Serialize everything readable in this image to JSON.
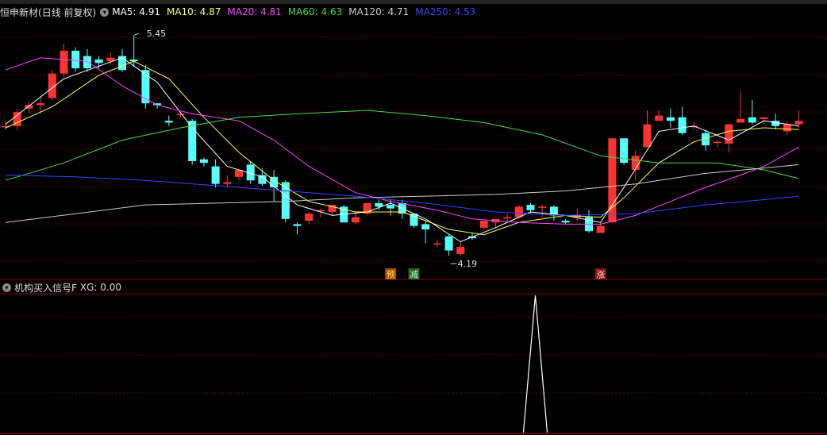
{
  "stock": {
    "name": "恒申新材",
    "period": "(日线 前复权)"
  },
  "ma_legend": [
    {
      "label": "MA5: 4.91",
      "color": "#ffffff"
    },
    {
      "label": "MA10: 4.87",
      "color": "#ffff55"
    },
    {
      "label": "MA20: 4.81",
      "color": "#ff44ff"
    },
    {
      "label": "MA60: 4.63",
      "color": "#44dd44"
    },
    {
      "label": "MA120: 4.71",
      "color": "#cccccc"
    },
    {
      "label": "MA250: 4.53",
      "color": "#3344ff"
    }
  ],
  "indicator": {
    "name": "机构买入信号F",
    "value_label": "XG: 0.00"
  },
  "colors": {
    "up": "#ff3333",
    "down": "#54ffff",
    "grid": "#6e0000",
    "border": "#a00000"
  },
  "signals": [
    {
      "label": "预",
      "index": 33,
      "bg": "#aa4400",
      "color": "#ffee66"
    },
    {
      "label": "减",
      "index": 35,
      "bg": "#226622",
      "color": "#ccffcc"
    },
    {
      "label": "涨",
      "index": 51,
      "bg": "#881111",
      "color": "#ffdddd"
    }
  ],
  "chart_data": {
    "type": "candlestick",
    "price_range": [
      4.1,
      5.55
    ],
    "annotations": [
      {
        "text": "5.45",
        "index": 11,
        "price": 5.45,
        "kind": "high"
      },
      {
        "text": "4.19",
        "index": 38,
        "price": 4.19,
        "kind": "low"
      }
    ],
    "candles": [
      [
        4.93,
        4.96,
        4.93,
        4.91
      ],
      [
        4.93,
        5.03,
        5.01,
        4.91
      ],
      [
        5.03,
        5.07,
        5.05,
        5.0
      ],
      [
        5.05,
        5.1,
        5.06,
        5.0
      ],
      [
        5.09,
        5.25,
        5.23,
        5.08
      ],
      [
        5.23,
        5.4,
        5.36,
        5.21
      ],
      [
        5.36,
        5.38,
        5.26,
        5.24
      ],
      [
        5.33,
        5.37,
        5.26,
        5.24
      ],
      [
        5.31,
        5.33,
        5.29,
        5.26
      ],
      [
        5.3,
        5.35,
        5.32,
        5.28
      ],
      [
        5.33,
        5.37,
        5.25,
        5.24
      ],
      [
        5.31,
        5.45,
        5.3,
        5.27
      ],
      [
        5.25,
        5.28,
        5.06,
        5.03
      ],
      [
        5.06,
        5.06,
        5.05,
        5.03
      ],
      [
        4.96,
        4.99,
        4.95,
        4.93
      ],
      [
        5.0,
        5.01,
        5.0,
        4.98
      ],
      [
        4.96,
        4.97,
        4.73,
        4.71
      ],
      [
        4.74,
        4.75,
        4.72,
        4.7
      ],
      [
        4.7,
        4.74,
        4.6,
        4.58
      ],
      [
        4.6,
        4.65,
        4.61,
        4.58
      ],
      [
        4.64,
        4.67,
        4.68,
        4.62
      ],
      [
        4.71,
        4.73,
        4.62,
        4.6
      ],
      [
        4.65,
        4.69,
        4.6,
        4.59
      ],
      [
        4.64,
        4.68,
        4.58,
        4.5
      ],
      [
        4.61,
        4.62,
        4.4,
        4.38
      ],
      [
        4.37,
        4.38,
        4.36,
        4.31
      ],
      [
        4.39,
        4.44,
        4.43,
        4.37
      ],
      [
        4.45,
        4.46,
        4.45,
        4.41
      ],
      [
        4.44,
        4.46,
        4.48,
        4.42
      ],
      [
        4.47,
        4.48,
        4.38,
        4.38
      ],
      [
        4.38,
        4.44,
        4.41,
        4.37
      ],
      [
        4.43,
        4.48,
        4.49,
        4.42
      ],
      [
        4.49,
        4.51,
        4.47,
        4.45
      ],
      [
        4.48,
        4.51,
        4.46,
        4.42
      ],
      [
        4.49,
        4.51,
        4.43,
        4.4
      ],
      [
        4.43,
        4.43,
        4.36,
        4.35
      ],
      [
        4.37,
        4.39,
        4.34,
        4.26
      ],
      [
        4.26,
        4.28,
        4.26,
        4.24
      ],
      [
        4.3,
        4.31,
        4.22,
        4.19
      ],
      [
        4.2,
        4.27,
        4.24,
        4.19
      ],
      [
        4.3,
        4.32,
        4.29,
        4.28
      ],
      [
        4.35,
        4.38,
        4.39,
        4.34
      ],
      [
        4.38,
        4.4,
        4.4,
        4.35
      ],
      [
        4.41,
        4.43,
        4.41,
        4.39
      ],
      [
        4.41,
        4.48,
        4.47,
        4.4
      ],
      [
        4.48,
        4.49,
        4.45,
        4.43
      ],
      [
        4.47,
        4.48,
        4.47,
        4.41
      ],
      [
        4.47,
        4.48,
        4.42,
        4.39
      ],
      [
        4.39,
        4.4,
        4.38,
        4.37
      ],
      [
        4.41,
        4.46,
        4.42,
        4.39
      ],
      [
        4.41,
        4.45,
        4.33,
        4.32
      ],
      [
        4.32,
        4.38,
        4.36,
        4.34
      ],
      [
        4.38,
        4.86,
        4.86,
        4.4
      ],
      [
        4.86,
        4.86,
        4.72,
        4.71
      ],
      [
        4.68,
        4.79,
        4.76,
        4.62
      ],
      [
        4.81,
        5.02,
        4.94,
        4.81
      ],
      [
        4.96,
        5.02,
        4.99,
        4.96
      ],
      [
        4.98,
        5.03,
        4.96,
        4.92
      ],
      [
        4.98,
        5.04,
        4.89,
        4.88
      ],
      [
        4.93,
        4.95,
        4.93,
        4.91
      ],
      [
        4.89,
        4.91,
        4.82,
        4.79
      ],
      [
        4.84,
        4.85,
        4.84,
        4.81
      ],
      [
        4.83,
        4.9,
        4.94,
        4.78
      ],
      [
        4.95,
        5.13,
        4.97,
        4.95
      ],
      [
        4.98,
        5.08,
        4.95,
        4.94
      ],
      [
        4.97,
        4.98,
        4.98,
        4.94
      ],
      [
        4.96,
        5.0,
        4.93,
        4.91
      ],
      [
        4.9,
        4.96,
        4.94,
        4.88
      ],
      [
        4.94,
        5.02,
        4.96,
        4.92
      ]
    ],
    "ma_lines": [
      {
        "name": "MA5",
        "color": "#ffffff",
        "points": [
          [
            0,
            4.94
          ],
          [
            5,
            5.2
          ],
          [
            10,
            5.32
          ],
          [
            13,
            5.18
          ],
          [
            16,
            4.92
          ],
          [
            19,
            4.7
          ],
          [
            22,
            4.64
          ],
          [
            25,
            4.48
          ],
          [
            28,
            4.42
          ],
          [
            31,
            4.44
          ],
          [
            33,
            4.49
          ],
          [
            36,
            4.4
          ],
          [
            39,
            4.27
          ],
          [
            42,
            4.35
          ],
          [
            45,
            4.44
          ],
          [
            48,
            4.42
          ],
          [
            51,
            4.38
          ],
          [
            53,
            4.58
          ],
          [
            56,
            4.9
          ],
          [
            59,
            4.93
          ],
          [
            62,
            4.85
          ],
          [
            65,
            4.96
          ],
          [
            68,
            4.93
          ]
        ]
      },
      {
        "name": "MA10",
        "color": "#ffff55",
        "points": [
          [
            0,
            4.92
          ],
          [
            4,
            5.04
          ],
          [
            8,
            5.22
          ],
          [
            11,
            5.3
          ],
          [
            14,
            5.2
          ],
          [
            17,
            4.98
          ],
          [
            20,
            4.78
          ],
          [
            23,
            4.62
          ],
          [
            26,
            4.5
          ],
          [
            30,
            4.44
          ],
          [
            34,
            4.44
          ],
          [
            38,
            4.34
          ],
          [
            41,
            4.31
          ],
          [
            44,
            4.38
          ],
          [
            48,
            4.42
          ],
          [
            51,
            4.41
          ],
          [
            53,
            4.52
          ],
          [
            56,
            4.72
          ],
          [
            59,
            4.84
          ],
          [
            62,
            4.9
          ],
          [
            65,
            4.92
          ],
          [
            68,
            4.91
          ]
        ]
      },
      {
        "name": "MA20",
        "color": "#ff44ff",
        "points": [
          [
            0,
            5.25
          ],
          [
            3,
            5.32
          ],
          [
            7,
            5.3
          ],
          [
            10,
            5.16
          ],
          [
            13,
            5.05
          ],
          [
            16,
            5.0
          ],
          [
            20,
            4.96
          ],
          [
            23,
            4.85
          ],
          [
            26,
            4.7
          ],
          [
            30,
            4.55
          ],
          [
            33,
            4.5
          ],
          [
            37,
            4.45
          ],
          [
            40,
            4.4
          ],
          [
            44,
            4.38
          ],
          [
            48,
            4.37
          ],
          [
            51,
            4.37
          ],
          [
            54,
            4.42
          ],
          [
            57,
            4.5
          ],
          [
            60,
            4.58
          ],
          [
            63,
            4.65
          ],
          [
            65,
            4.7
          ],
          [
            68,
            4.81
          ]
        ]
      },
      {
        "name": "MA60",
        "color": "#44dd44",
        "points": [
          [
            0,
            4.62
          ],
          [
            5,
            4.72
          ],
          [
            10,
            4.85
          ],
          [
            15,
            4.92
          ],
          [
            20,
            4.98
          ],
          [
            25,
            5.0
          ],
          [
            31,
            5.02
          ],
          [
            36,
            4.99
          ],
          [
            41,
            4.95
          ],
          [
            46,
            4.88
          ],
          [
            51,
            4.76
          ],
          [
            56,
            4.72
          ],
          [
            61,
            4.72
          ],
          [
            65,
            4.68
          ],
          [
            68,
            4.63
          ]
        ]
      },
      {
        "name": "MA120",
        "color": "#cccccc",
        "points": [
          [
            0,
            4.38
          ],
          [
            6,
            4.43
          ],
          [
            12,
            4.48
          ],
          [
            18,
            4.49
          ],
          [
            24,
            4.5
          ],
          [
            30,
            4.52
          ],
          [
            36,
            4.53
          ],
          [
            42,
            4.54
          ],
          [
            48,
            4.56
          ],
          [
            54,
            4.6
          ],
          [
            60,
            4.66
          ],
          [
            65,
            4.69
          ],
          [
            68,
            4.71
          ]
        ]
      },
      {
        "name": "MA250",
        "color": "#3344ff",
        "points": [
          [
            0,
            4.65
          ],
          [
            6,
            4.64
          ],
          [
            12,
            4.62
          ],
          [
            18,
            4.59
          ],
          [
            24,
            4.56
          ],
          [
            30,
            4.53
          ],
          [
            36,
            4.49
          ],
          [
            42,
            4.44
          ],
          [
            48,
            4.42
          ],
          [
            54,
            4.43
          ],
          [
            60,
            4.48
          ],
          [
            65,
            4.51
          ],
          [
            68,
            4.53
          ]
        ]
      }
    ],
    "indicator_series": {
      "name": "XG",
      "ymax": 1,
      "spike_index": 45,
      "spike_value": 1
    }
  }
}
